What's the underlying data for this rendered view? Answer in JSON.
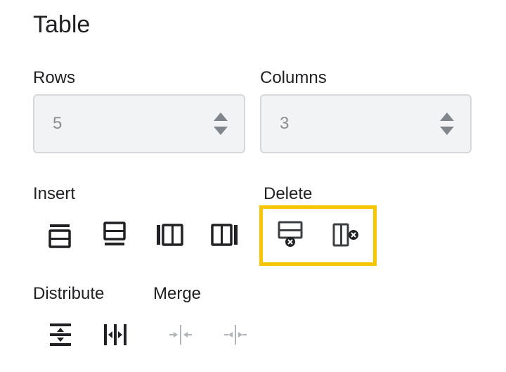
{
  "panel": {
    "title": "Table"
  },
  "rows": {
    "label": "Rows",
    "value": "5"
  },
  "columns": {
    "label": "Columns",
    "value": "3"
  },
  "sections": {
    "insert": "Insert",
    "delete": "Delete",
    "distribute": "Distribute",
    "merge": "Merge"
  },
  "colors": {
    "highlight": "#f6c700",
    "icon": "#202124",
    "disabled": "#b0b3b8"
  },
  "icons": {
    "insert": [
      "insert-row-above-icon",
      "insert-row-below-icon",
      "insert-column-left-icon",
      "insert-column-right-icon"
    ],
    "delete": [
      "delete-row-icon",
      "delete-column-icon"
    ],
    "distribute": [
      "distribute-rows-icon",
      "distribute-columns-icon"
    ],
    "merge": [
      "merge-cells-icon",
      "unmerge-cells-icon"
    ]
  }
}
